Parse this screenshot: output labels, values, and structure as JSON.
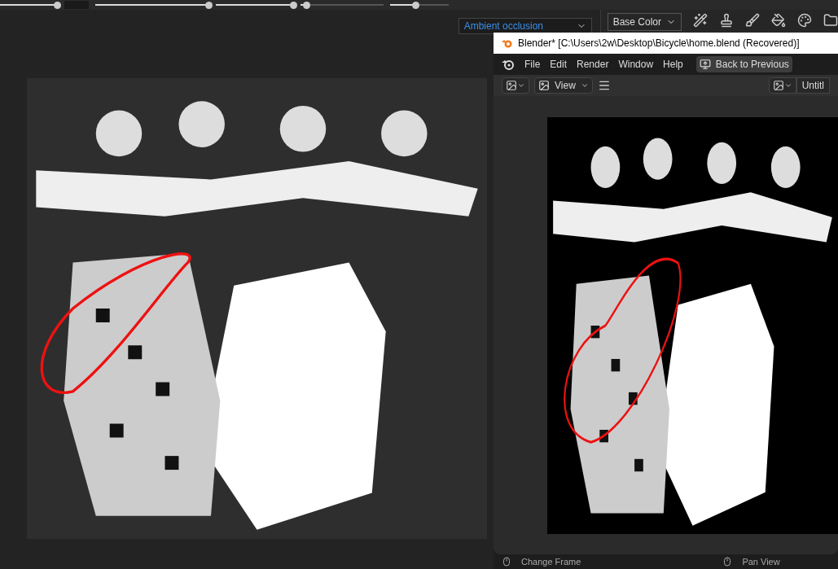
{
  "editor": {
    "sliders": [
      {
        "level": 1
      },
      {
        "level": 1
      },
      {
        "level": 1
      },
      {
        "level": 0.08
      },
      {
        "level": 0.45
      }
    ],
    "bake_dropdown": "Ambient occlusion",
    "channel_dropdown": "Base Color"
  },
  "blender": {
    "title": "Blender* [C:\\Users\\2w\\Desktop\\Bicycle\\home.blend (Recovered)]",
    "menu": [
      "File",
      "Edit",
      "Render",
      "Window",
      "Help"
    ],
    "back_button": "Back to Previous",
    "header": {
      "view_menu": "View",
      "image_name": "Untitl"
    },
    "status_bar": [
      "Change Frame",
      "Pan View"
    ]
  }
}
